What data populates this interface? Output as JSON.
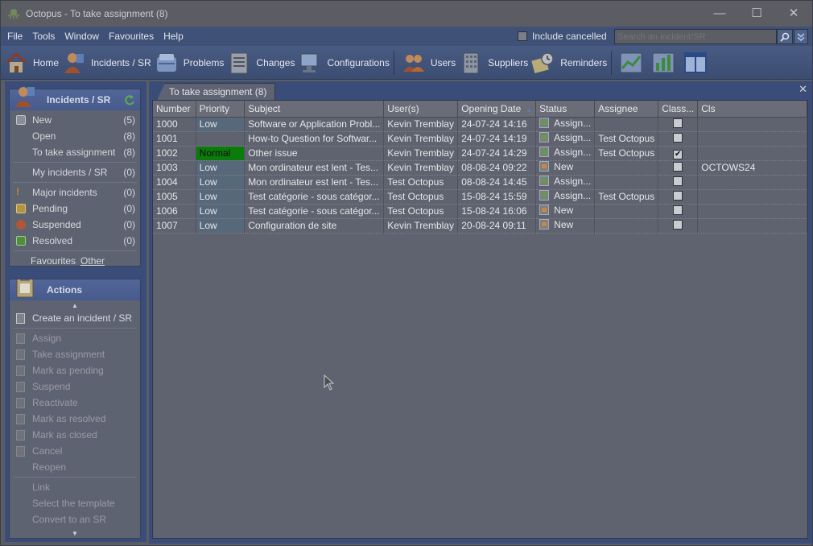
{
  "window": {
    "title": "Octopus - To take assignment (8)",
    "minimize_icon": "—",
    "maximize_icon": "☐",
    "close_icon": "✕"
  },
  "menu": {
    "items": [
      "File",
      "Tools",
      "Window",
      "Favourites",
      "Help"
    ],
    "include_cancelled_label": "Include cancelled",
    "include_cancelled_checked": false,
    "search_placeholder": "Search an incident/SR",
    "search_icon": "⌕",
    "options_icon": "⌄"
  },
  "toolbar": {
    "items": [
      {
        "label": "Home",
        "icon": "home-icon"
      },
      {
        "label": "Incidents / SR",
        "icon": "incidents-icon"
      },
      {
        "label": "Problems",
        "icon": "problems-icon"
      },
      {
        "label": "Changes",
        "icon": "changes-icon"
      },
      {
        "label": "Configurations",
        "icon": "configurations-icon"
      },
      {
        "label": "Users",
        "icon": "users-icon"
      },
      {
        "label": "Suppliers",
        "icon": "suppliers-icon"
      },
      {
        "label": "Reminders",
        "icon": "reminders-icon"
      }
    ]
  },
  "incidents_panel": {
    "title": "Incidents / SR",
    "group1": [
      {
        "label": "New",
        "count": "(5)",
        "icon": "new-icon"
      },
      {
        "label": "Open",
        "count": "(8)"
      },
      {
        "label": "To take assignment",
        "count": "(8)"
      }
    ],
    "group2": [
      {
        "label": "My incidents / SR",
        "count": "(0)"
      }
    ],
    "group3": [
      {
        "label": "Major incidents",
        "count": "(0)",
        "icon": "major-icon"
      },
      {
        "label": "Pending",
        "count": "(0)",
        "icon": "pending-icon"
      },
      {
        "label": "Suspended",
        "count": "(0)",
        "icon": "suspended-icon"
      },
      {
        "label": "Resolved",
        "count": "(0)",
        "icon": "resolved-icon"
      }
    ],
    "favourites_label": "Favourites",
    "other_label": "Other"
  },
  "actions_panel": {
    "title": "Actions",
    "up_arrow": "▲",
    "down_arrow": "▼",
    "items": [
      {
        "label": "Create an incident / SR",
        "enabled": true
      },
      {
        "label": "Assign",
        "enabled": false
      },
      {
        "label": "Take assignment",
        "enabled": false
      },
      {
        "label": "Mark as pending",
        "enabled": false
      },
      {
        "label": "Suspend",
        "enabled": false
      },
      {
        "label": "Reactivate",
        "enabled": false
      },
      {
        "label": "Mark as resolved",
        "enabled": false
      },
      {
        "label": "Mark as closed",
        "enabled": false
      },
      {
        "label": "Cancel",
        "enabled": false
      },
      {
        "label": "Reopen",
        "enabled": false
      },
      {
        "label": "Link",
        "enabled": false
      },
      {
        "label": "Select the template",
        "enabled": false
      },
      {
        "label": "Convert to an SR",
        "enabled": false
      }
    ]
  },
  "tab": {
    "label": "To take assignment (8)",
    "close": "✕"
  },
  "grid": {
    "columns": [
      "Number",
      "Priority",
      "Subject",
      "User(s)",
      "Opening Date",
      "Status",
      "Assignee",
      "Class...",
      "Cls"
    ],
    "sort_indicator": "▲",
    "rows": [
      {
        "number": "1000",
        "priority": "Low",
        "subject": "Software or Application Probl...",
        "users": "Kevin Tremblay",
        "date": "24-07-24 14:16",
        "status": "Assign...",
        "status_type": "assign",
        "assignee": "",
        "classified": false,
        "cls": ""
      },
      {
        "number": "1001",
        "priority": "",
        "subject": "How-to Question for Softwar...",
        "users": "Kevin Tremblay",
        "date": "24-07-24 14:19",
        "status": "Assign...",
        "status_type": "assign",
        "assignee": "Test Octopus",
        "classified": false,
        "cls": ""
      },
      {
        "number": "1002",
        "priority": "Normal",
        "subject": "Other issue",
        "users": "Kevin Tremblay",
        "date": "24-07-24 14:29",
        "status": "Assign...",
        "status_type": "assign",
        "assignee": "Test Octopus",
        "classified": true,
        "cls": ""
      },
      {
        "number": "1003",
        "priority": "Low",
        "subject": "Mon ordinateur est lent - Tes...",
        "users": "Kevin Tremblay",
        "date": "08-08-24 09:22",
        "status": "New",
        "status_type": "new",
        "assignee": "",
        "classified": false,
        "cls": "OCTOWS24"
      },
      {
        "number": "1004",
        "priority": "Low",
        "subject": "Mon ordinateur est lent - Tes...",
        "users": "Test Octopus",
        "date": "08-08-24 14:45",
        "status": "Assign...",
        "status_type": "assign",
        "assignee": "",
        "classified": false,
        "cls": ""
      },
      {
        "number": "1005",
        "priority": "Low",
        "subject": "Test catégorie - sous catégor...",
        "users": "Test Octopus",
        "date": "15-08-24 15:59",
        "status": "Assign...",
        "status_type": "assign",
        "assignee": "Test Octopus",
        "classified": false,
        "cls": ""
      },
      {
        "number": "1006",
        "priority": "Low",
        "subject": "Test catégorie - sous catégor...",
        "users": "Test Octopus",
        "date": "15-08-24 16:06",
        "status": "New",
        "status_type": "new",
        "assignee": "",
        "classified": false,
        "cls": ""
      },
      {
        "number": "1007",
        "priority": "Low",
        "subject": "Configuration de site",
        "users": "Kevin Tremblay",
        "date": "20-08-24 09:11",
        "status": "New",
        "status_type": "new",
        "assignee": "",
        "classified": false,
        "cls": ""
      }
    ]
  },
  "colors": {
    "priority_low": "#56687a",
    "priority_normal": "#0b7b0b",
    "toolbar_bg": "#485b82"
  }
}
